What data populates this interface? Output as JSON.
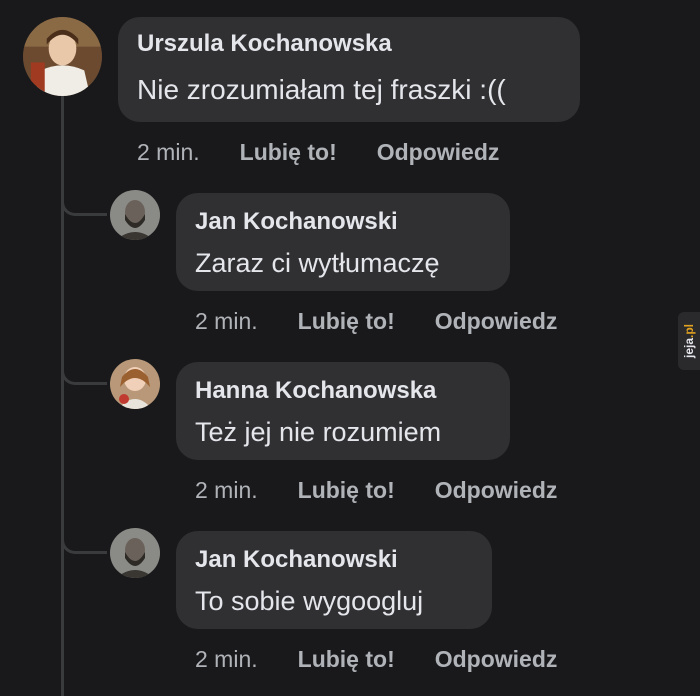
{
  "comments": [
    {
      "author": "Urszula Kochanowska",
      "text": "Nie zrozumiałam tej fraszki :((",
      "time": "2 min.",
      "like_label": "Lubię to!",
      "reply_label": "Odpowiedz"
    },
    {
      "author": "Jan Kochanowski",
      "text": "Zaraz ci wytłumaczę",
      "time": "2 min.",
      "like_label": "Lubię to!",
      "reply_label": "Odpowiedz"
    },
    {
      "author": "Hanna Kochanowska",
      "text": "Też jej nie rozumiem",
      "time": "2 min.",
      "like_label": "Lubię to!",
      "reply_label": "Odpowiedz"
    },
    {
      "author": "Jan Kochanowski",
      "text": "To sobie wygoogluj",
      "time": "2 min.",
      "like_label": "Lubię to!",
      "reply_label": "Odpowiedz"
    }
  ],
  "watermark": {
    "main": "jeja",
    "accent": ".pl"
  },
  "colors": {
    "background": "#19191b",
    "bubble": "#303032",
    "text": "#e4e6eb",
    "secondary_text": "#b0b3b8"
  }
}
